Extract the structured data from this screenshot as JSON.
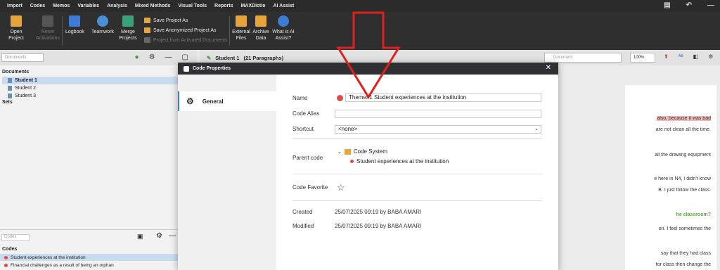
{
  "menu": {
    "items": [
      "Import",
      "Codes",
      "Memos",
      "Variables",
      "Analysis",
      "Mixed Methods",
      "Visual Tools",
      "Reports",
      "MAXDictio",
      "AI Assist"
    ]
  },
  "ribbon": {
    "open_project": "Open Project",
    "reset_activations": "Reset Activations",
    "logbook": "Logbook",
    "teamwork": "Teamwork",
    "merge_projects": "Merge Projects",
    "save_project_as": "Save Project As",
    "save_anonymized": "Save Anonymized Project As",
    "project_from_docs": "Project from Activated Documents",
    "external_files": "External Files",
    "archive_data": "Archive Data",
    "what_is_ai": "What is AI Assist?"
  },
  "left": {
    "search_placeholder": "Documents",
    "documents_header": "Documents",
    "documents": [
      "Student 1",
      "Student 2",
      "Student 3"
    ],
    "sets_header": "Sets",
    "lower_search": "Codes",
    "codes_header": "Codes",
    "codes": [
      "Student experiences at the institution",
      "Financial challenges as a result of being an orphan"
    ]
  },
  "doc": {
    "title": "Student 1",
    "paragraphs": "(21 Paragraphs)",
    "search_placeholder": "Document",
    "zoom": "100%",
    "lines": [
      "also, because it was bad",
      "are not clean all the time.",
      "all the drawing equipment",
      "e here in N4, I didn't know",
      "B. I just follow the class.",
      "he classroom?",
      "on. I feel sometimes the",
      "say that they had class",
      "for class then change the"
    ]
  },
  "dialog": {
    "title": "Code Properties",
    "nav_general": "General",
    "name_label": "Name",
    "name_value": "Theme#1 Student experiences at the institution",
    "alias_label": "Code Alias",
    "alias_value": "",
    "shortcut_label": "Shortcut",
    "shortcut_value": "<none>",
    "parent_label": "Parent code",
    "parent_root": "Code System",
    "parent_child": "Student experiences at the institution",
    "favorite_label": "Code Favorite",
    "created_label": "Created",
    "created_value": "25/07/2025 09:19 by BABA  AMARI",
    "modified_label": "Modified",
    "modified_value": "25/07/2025 09:19 by BABA  AMARI",
    "code_color": "#e04b4b"
  },
  "annotation": {
    "arrow_color": "#e0201e"
  }
}
